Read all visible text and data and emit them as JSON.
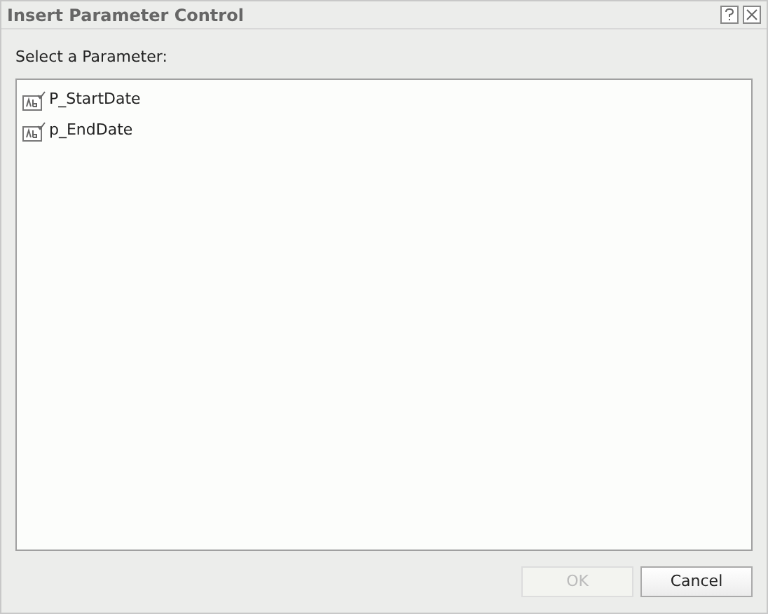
{
  "window": {
    "title": "Insert Parameter Control"
  },
  "prompt": "Select a Parameter:",
  "parameters": [
    {
      "name": "P_StartDate",
      "selected": false
    },
    {
      "name": "p_EndDate",
      "selected": false
    }
  ],
  "buttons": [
    {
      "label": "OK",
      "disabled": true
    },
    {
      "label": "Cancel",
      "disabled": false
    }
  ]
}
